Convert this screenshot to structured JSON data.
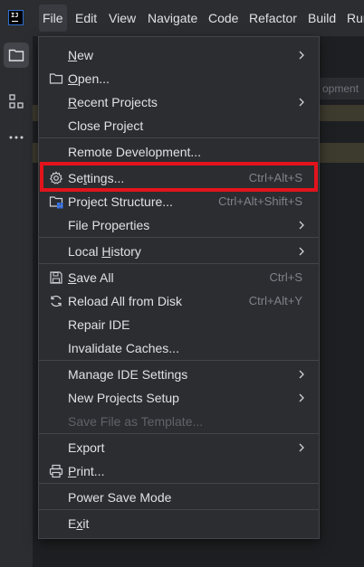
{
  "app": {
    "logo_text": "IJ"
  },
  "menubar": {
    "items": [
      {
        "label": "File"
      },
      {
        "label": "Edit"
      },
      {
        "label": "View"
      },
      {
        "label": "Navigate"
      },
      {
        "label": "Code"
      },
      {
        "label": "Refactor"
      },
      {
        "label": "Build"
      },
      {
        "label": "Run"
      }
    ]
  },
  "toolstrip": {
    "icons": [
      "folder-icon",
      "structure-icon",
      "more-icon"
    ]
  },
  "background": {
    "partial_text": "opment"
  },
  "file_menu": {
    "items": [
      {
        "label": "New",
        "submenu": true
      },
      {
        "label": "Open...",
        "icon": "folder-icon"
      },
      {
        "label": "Recent Projects",
        "submenu": true
      },
      {
        "label": "Close Project"
      },
      {
        "label": "Remote Development..."
      },
      {
        "label": "Settings...",
        "shortcut": "Ctrl+Alt+S",
        "icon": "gear-icon",
        "highlighted": true
      },
      {
        "label": "Project Structure...",
        "shortcut": "Ctrl+Alt+Shift+S",
        "icon": "project-structure-icon"
      },
      {
        "label": "File Properties",
        "submenu": true
      },
      {
        "label": "Local History",
        "submenu": true
      },
      {
        "label": "Save All",
        "shortcut": "Ctrl+S",
        "icon": "save-icon"
      },
      {
        "label": "Reload All from Disk",
        "shortcut": "Ctrl+Alt+Y",
        "icon": "reload-icon"
      },
      {
        "label": "Repair IDE"
      },
      {
        "label": "Invalidate Caches..."
      },
      {
        "label": "Manage IDE Settings",
        "submenu": true
      },
      {
        "label": "New Projects Setup",
        "submenu": true
      },
      {
        "label": "Save File as Template...",
        "disabled": true
      },
      {
        "label": "Export",
        "submenu": true
      },
      {
        "label": "Print...",
        "icon": "print-icon"
      },
      {
        "label": "Power Save Mode"
      },
      {
        "label": "Exit"
      }
    ]
  },
  "colors": {
    "menu_bg": "#2b2d30",
    "text": "#dfe1e5",
    "shortcut": "#7f838a",
    "highlight_border": "#e3131c"
  }
}
